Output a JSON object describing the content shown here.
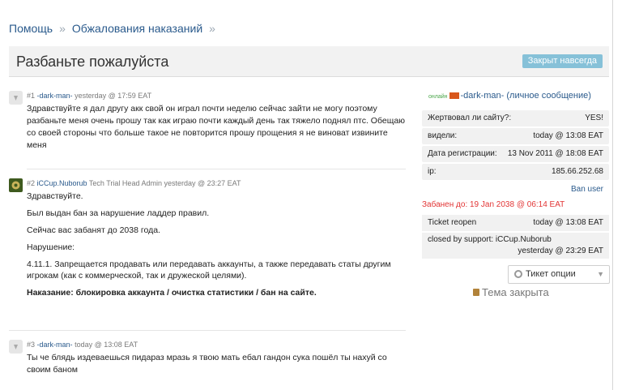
{
  "breadcrumb": {
    "home": "Помощь",
    "sep": "»",
    "section": "Обжалования наказаний"
  },
  "topic": {
    "title": "Разбаньте пожалуйста",
    "status_badge": "Закрыт навсегда"
  },
  "posts": [
    {
      "number": "#1",
      "author": "-dark-man-",
      "role": "",
      "time": "yesterday @ 17:59 EAT",
      "paragraphs": [
        "Здравствуйте я дал другу акк свой он играл почти неделю сейчас зайти не могу поэтому разбаньте меня очень прошу так как играю почти каждый день так тяжело поднял птс. Обещаю со своей стороны что больше такое не повторится прошу прощения я не виноват извините меня"
      ]
    },
    {
      "number": "#2",
      "author": "iCCup.Nuborub",
      "role": "Tech Trial Head Admin",
      "time": "yesterday @ 23:27 EAT",
      "paragraphs": [
        "Здравствуйте.",
        "Был выдан бан за нарушение ладдер правил.",
        "Сейчас вас забанят до 2038 года.",
        "Нарушение:",
        "4.11.1. Запрещается продавать или передавать аккаунты, а также передавать статы другим игрокам (как с коммерческой, так и дружеской целями).",
        "Наказание: блокировка аккаунта / очистка статистики / бан на сайте."
      ]
    },
    {
      "number": "#3",
      "author": "-dark-man-",
      "role": "",
      "time": "today @ 13:08 EAT",
      "paragraphs": [
        "Ты че блядь издеваешься пидараз мразь я твою мать ебал гандон сука пошёл ты нахуй со своим баном"
      ]
    }
  ],
  "sidebar": {
    "online_label": "онлайн",
    "user_name": "-dark-man-",
    "pm_label": "(личное сообщение)",
    "rows": [
      {
        "label": "Жертвовал ли сайту?:",
        "value": "YES!"
      },
      {
        "label": "видели:",
        "value": "today @ 13:08 EAT"
      },
      {
        "label": "Дата регистрации:",
        "value": "13 Nov 2011 @ 18:08 EAT"
      },
      {
        "label": "ip:",
        "value": "185.66.252.68"
      }
    ],
    "ban_user": "Ban user",
    "banned_until": "Забанен до: 19 Jan 2038 @ 06:14 EAT",
    "reopen": {
      "label": "Ticket reopen",
      "value": "today @ 13:08 EAT"
    },
    "closed_by": {
      "label": "closed by support: iCCup.Nuborub",
      "time": "yesterday @ 23:29 EAT"
    },
    "options_select": "Тикет опции",
    "topic_closed": "Тема закрыта"
  },
  "colors": {
    "link": "#2a5a8c",
    "badge": "#86c1d8",
    "ban": "#e23535"
  }
}
